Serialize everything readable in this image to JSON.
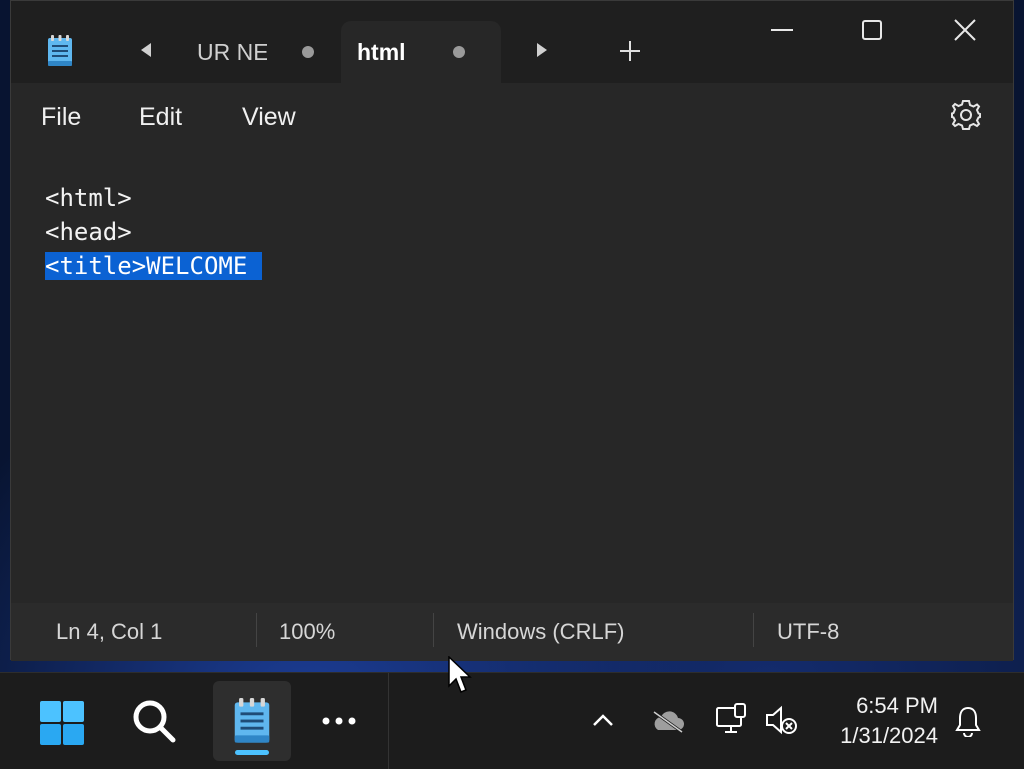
{
  "window": {
    "tabs": [
      {
        "label": "UR NE",
        "modified": true,
        "active": false
      },
      {
        "label": "html",
        "modified": true,
        "active": true
      }
    ],
    "icons": {
      "app": "notepad-icon",
      "scroll_left": "tab-scroll-left-icon",
      "scroll_right": "tab-scroll-right-icon",
      "new_tab": "plus-icon",
      "minimize": "minimize-icon",
      "maximize": "maximize-icon",
      "close": "close-icon",
      "settings": "gear-icon"
    }
  },
  "menu": {
    "file": "File",
    "edit": "Edit",
    "view": "View"
  },
  "editor": {
    "lines": [
      "<html>",
      "<head>",
      "<title>WELCOME "
    ],
    "selected_line": 3,
    "selection_color": "#0b62d3"
  },
  "status": {
    "position": "Ln 4, Col 1",
    "zoom": "100%",
    "line_ending": "Windows (CRLF)",
    "encoding": "UTF-8"
  },
  "taskbar": {
    "clock_time": "6:54 PM",
    "clock_date": "1/31/2024",
    "icons": [
      "windows-start-icon",
      "search-icon",
      "notepad-icon",
      "more-icon",
      "chevron-up-icon",
      "onedrive-icon",
      "network-icon",
      "volume-muted-icon",
      "bell-icon"
    ]
  },
  "colors": {
    "titlebar_bg": "#1f1f1f",
    "editor_bg": "#272727",
    "accent": "#0b62d3",
    "taskbar_bg": "#1c1c1c"
  }
}
